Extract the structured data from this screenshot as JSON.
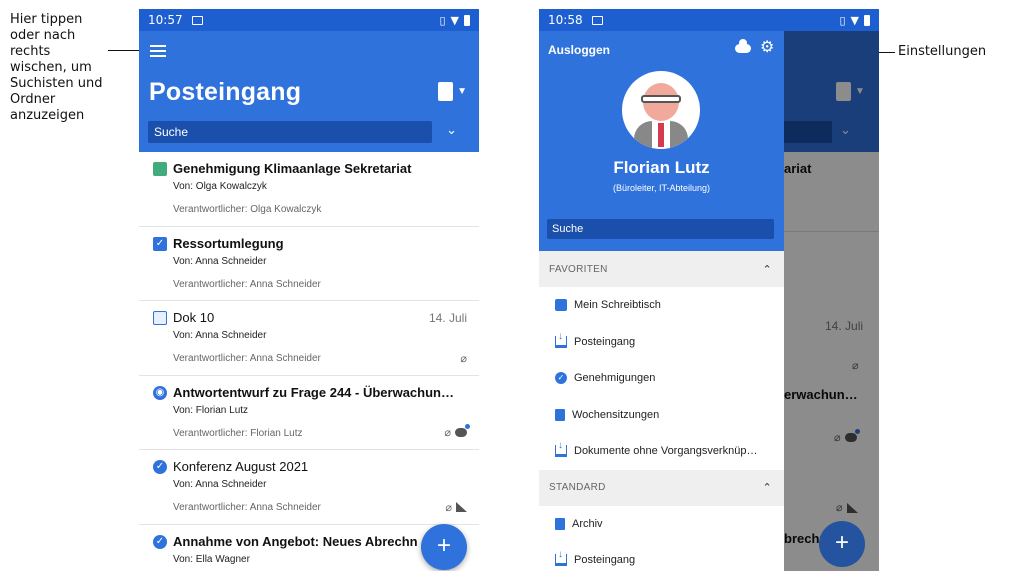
{
  "callouts": {
    "left": "Hier tippen oder nach rechts wischen, um Suchisten und Ordner anzuzeigen",
    "right": "Einstellungen"
  },
  "phone1": {
    "time": "10:57",
    "title": "Posteingang",
    "search_placeholder": "Suche",
    "items": [
      {
        "title": "Genehmigung Klimaanlage Sekretariat",
        "from": "Von: Olga Kowalczyk",
        "resp": "Verantwortlicher: Olga Kowalczyk",
        "date": ""
      },
      {
        "title": "Ressortumlegung",
        "from": "Von: Anna Schneider",
        "resp": "Verantwortlicher: Anna Schneider",
        "date": ""
      },
      {
        "title": "Dok 10",
        "from": "Von: Anna Schneider",
        "resp": "Verantwortlicher: Anna Schneider",
        "date": "14. Juli"
      },
      {
        "title": "Antwortentwurf zu Frage 244 - Überwachun…",
        "from": "Von: Florian Lutz",
        "resp": "Verantwortlicher: Florian Lutz",
        "date": ""
      },
      {
        "title": "Konferenz August 2021",
        "from": "Von: Anna Schneider",
        "resp": "Verantwortlicher: Anna Schneider",
        "date": ""
      },
      {
        "title": "Annahme von Angebot: Neues Abrechn",
        "from": "Von: Ella Wagner",
        "resp": "",
        "date": ""
      }
    ],
    "fab": "+"
  },
  "phone2": {
    "time": "10:58",
    "logout": "Ausloggen",
    "user_name": "Florian Lutz",
    "user_role": "(Büroleiter, IT-Abteilung)",
    "search_placeholder": "Suche",
    "sections": [
      {
        "label": "FAVORITEN",
        "items": [
          "Mein Schreibtisch",
          "Posteingang",
          "Genehmigungen",
          "Wochensitzungen",
          "Dokumente ohne Vorgangsverknüp…"
        ]
      },
      {
        "label": "STANDARD",
        "items": [
          "Archiv",
          "Posteingang"
        ]
      }
    ],
    "peek": {
      "item1": "ariat",
      "date": "14. Juli",
      "item4": "erwachun…",
      "item6": "brechn"
    },
    "fab": "+"
  },
  "colors": {
    "primary": "#2f72dc",
    "status_bar": "#1d5fd0",
    "search_bg": "#1a4fab"
  }
}
